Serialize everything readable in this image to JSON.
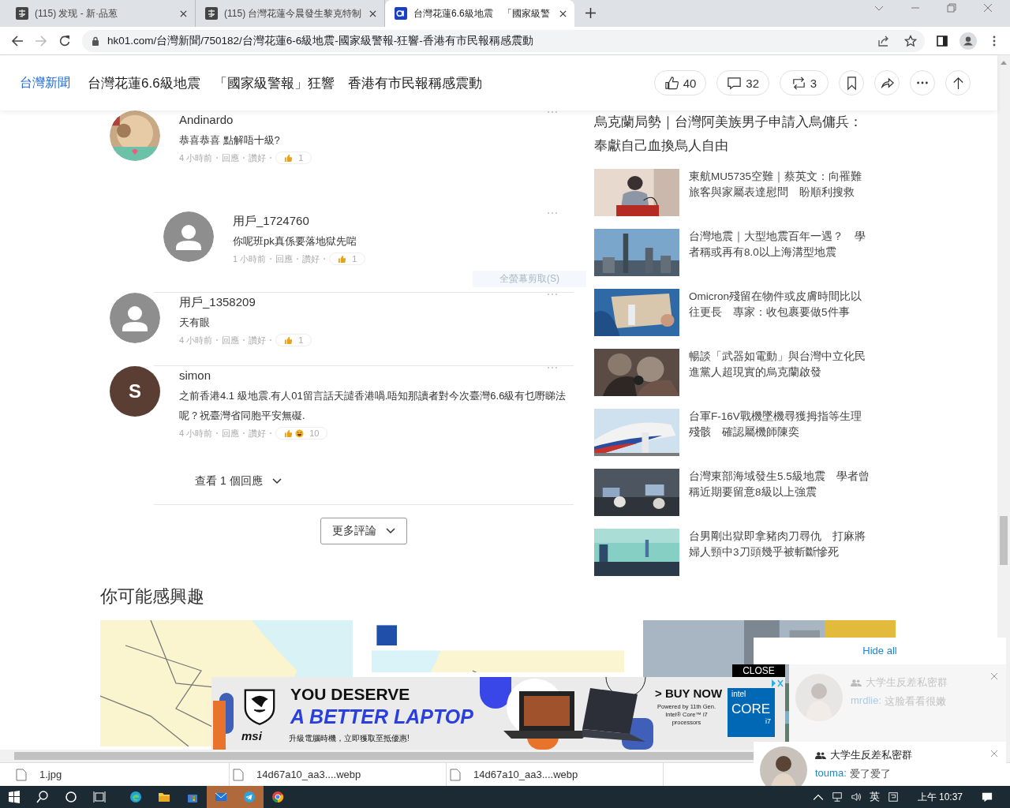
{
  "browser": {
    "tabs": [
      {
        "title": "(115) 发现 - 新·品葱",
        "kind": "square",
        "selected": false
      },
      {
        "title": "(115) 台灣花蓮今晨發生黎克特制",
        "kind": "square",
        "selected": false
      },
      {
        "title": "台灣花蓮6.6級地震　「國家級警",
        "kind": "hk01",
        "selected": true
      }
    ],
    "url": "hk01.com/台灣新聞/750182/台灣花蓮6-6級地震-國家級警報-狂響-香港有市民報稱感震動"
  },
  "header": {
    "section": "台灣新聞",
    "title": "台灣花蓮6.6級地震　「國家級警報」狂響　香港有市民報稱感震動",
    "actions": [
      {
        "kind": "like",
        "count": "40"
      },
      {
        "kind": "comment",
        "count": "32"
      },
      {
        "kind": "repost",
        "count": "3"
      },
      {
        "kind": "bookmark"
      },
      {
        "kind": "share"
      },
      {
        "kind": "more"
      },
      {
        "kind": "top"
      }
    ]
  },
  "comments": [
    {
      "author": "Andinardo",
      "avatar": {
        "kind": "picture"
      },
      "text": "恭喜恭喜 點解唔十級?",
      "time": "4 小時前",
      "reply": "回應",
      "like": "讚好",
      "reactions": [
        {
          "kind": "like"
        }
      ],
      "reaction_count": "1",
      "children": [
        {
          "author": "用戶_1724760",
          "avatar": {
            "kind": "default"
          },
          "text": "你呢班pk真係要落地獄先啱",
          "time": "1 小時前",
          "reply": "回應",
          "like": "讚好",
          "reactions": [
            {
              "kind": "like"
            }
          ],
          "reaction_count": "1"
        }
      ]
    },
    {
      "author": "用戶_1358209",
      "avatar": {
        "kind": "default"
      },
      "text": "天有眼",
      "time": "4 小時前",
      "reply": "回應",
      "like": "讚好",
      "reactions": [
        {
          "kind": "like"
        }
      ],
      "reaction_count": "1"
    },
    {
      "author": "simon",
      "avatar": {
        "kind": "letter",
        "letter": "S"
      },
      "text": "之前香港4.1 級地震.有人01留言話天譴香港喎.唔知那讀者對今次臺灣6.6級有乜嘢睇法呢？祝臺灣省同胞平安無礙.",
      "time": "4 小時前",
      "reply": "回應",
      "like": "讚好",
      "reactions": [
        {
          "kind": "like"
        },
        {
          "kind": "laugh"
        }
      ],
      "reaction_count": "10",
      "view_replies": "查看 1 個回應"
    }
  ],
  "more_comments": "更多評論",
  "tooltip": "全螢幕剪取(S)",
  "sidebar": {
    "headline": "烏克蘭局勢｜台灣阿美族男子申請入烏傭兵：奉獻自己血換烏人自由",
    "items": [
      {
        "title": "東航MU5735空難｜蔡英文：向罹難旅客與家屬表達慰問　盼順利搜救"
      },
      {
        "title": "台灣地震｜大型地震百年一遇？　學者稱或再有8.0以上海溝型地震"
      },
      {
        "title": "Omicron殘留在物件或皮膚時間比以往更長　專家：收包裹要做5件事"
      },
      {
        "title": "暢談「武器如電動」與台灣中立化民進黨人超現實的烏克蘭啟發"
      },
      {
        "title": "台軍F-16V戰機墜機尋獲拇指等生理殘骸　確認屬機師陳奕"
      },
      {
        "title": "台灣東部海域發生5.5級地震　學者曾稱近期要留意8級以上強震"
      },
      {
        "title": "台男剛出獄即拿豬肉刀尋仇　打麻將婦人頸中3刀頭幾乎被斬斷慘死"
      }
    ]
  },
  "recommend": {
    "heading": "你可能感興趣",
    "cards": [
      {
        "kind": "picture"
      },
      {
        "kind": "picture"
      },
      {
        "kind": "picture"
      }
    ]
  },
  "ad": {
    "headline_1": "YOU DESERVE",
    "headline_2": "A BETTER LAPTOP",
    "brand": "msi",
    "tagline": "升級電腦時機，立即獲取至抵優惠!",
    "cta": "> BUY NOW",
    "fine_print": "Powered by 11th Gen. Intel® Core™ i7 processors",
    "chip_brand": "intel",
    "chip_name": "CORE",
    "chip_tier": "i7",
    "close": "CLOSE"
  },
  "notifications": {
    "hide_all": "Hide all",
    "items": [
      {
        "group": "大学生反差私密群",
        "sender": "mrdlie:",
        "message": "这脸看看很嫩",
        "faded": true
      },
      {
        "group": "大学生反差私密群",
        "sender": "touma:",
        "message": "爱了爱了",
        "faded": false
      }
    ]
  },
  "downloads": [
    {
      "name": "1.jpg"
    },
    {
      "name": "14d67a10_aa3....webp"
    },
    {
      "name": "14d67a10_aa3....webp"
    }
  ],
  "taskbar": {
    "apps": [
      {
        "kind": "edge",
        "active": false
      },
      {
        "kind": "folder",
        "active": false
      },
      {
        "kind": "store",
        "active": false
      },
      {
        "kind": "mail",
        "active": true
      },
      {
        "kind": "telegram",
        "active": true
      },
      {
        "kind": "chrome",
        "active": false
      }
    ],
    "ime": "英",
    "clock": "上午 10:37"
  }
}
